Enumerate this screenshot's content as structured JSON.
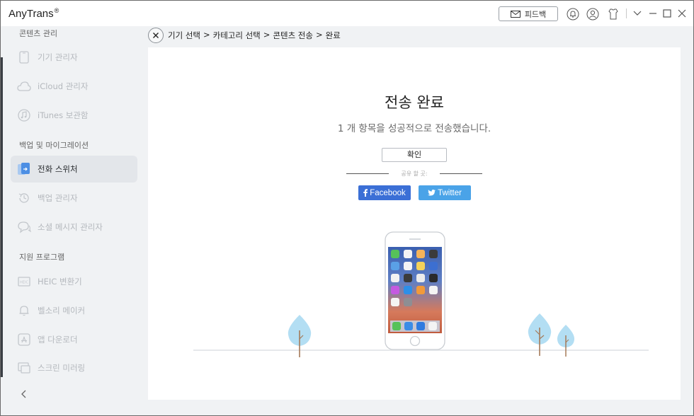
{
  "app": {
    "title": "AnyTrans",
    "trademark": "®"
  },
  "titlebar": {
    "feedback_label": "피드백"
  },
  "sidebar": {
    "sections": [
      {
        "label": "콘텐츠 관리"
      },
      {
        "label": "백업 및 마이그레이션"
      },
      {
        "label": "지원 프로그램"
      }
    ],
    "items": [
      {
        "label": "기기 관리자",
        "icon": "phone-icon"
      },
      {
        "label": "iCloud 관리자",
        "icon": "cloud-icon"
      },
      {
        "label": "iTunes 보관함",
        "icon": "music-icon"
      },
      {
        "label": "전화 스위처",
        "icon": "phone-switch-icon",
        "active": true
      },
      {
        "label": "백업 관리자",
        "icon": "history-icon"
      },
      {
        "label": "소셜 메시지 관리자",
        "icon": "chat-icon"
      },
      {
        "label": "HEIC 변환기",
        "icon": "heic-icon"
      },
      {
        "label": "벨소리 메이커",
        "icon": "bell-icon"
      },
      {
        "label": "앱 다운로더",
        "icon": "app-store-icon"
      },
      {
        "label": "스크린 미러링",
        "icon": "screen-mirror-icon"
      }
    ]
  },
  "breadcrumb": {
    "items": [
      "기기 선택",
      "카테고리 선택",
      "콘텐츠 전송",
      "완료"
    ],
    "separator": ">"
  },
  "main": {
    "title": "전송 완료",
    "subtitle": "1 개 항목을 성공적으로 전송했습니다.",
    "ok_label": "확인",
    "share_label": "공유 할 곳:",
    "facebook_label": "Facebook",
    "twitter_label": "Twitter"
  },
  "colors": {
    "facebook": "#3b6fd6",
    "twitter": "#4aa3e8",
    "tree": "#b3def3",
    "trunk": "#a57a58"
  }
}
